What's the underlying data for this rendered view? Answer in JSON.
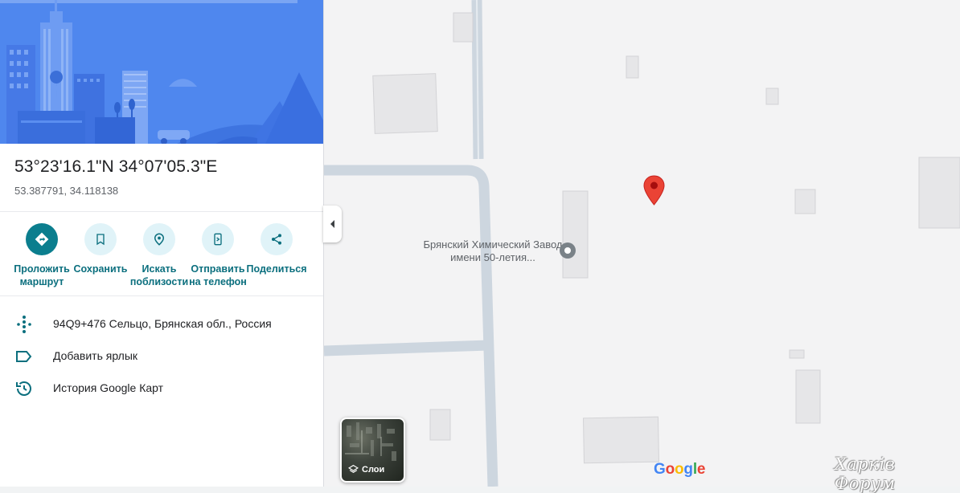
{
  "place": {
    "title": "53°23'16.1\"N 34°07'05.3\"E",
    "decimal": "53.387791, 34.118138"
  },
  "actions": [
    {
      "label": "Проложить\nмаршрут",
      "icon": "directions-icon"
    },
    {
      "label": "Сохранить",
      "icon": "bookmark-icon"
    },
    {
      "label": "Искать\nпоблизости",
      "icon": "nearby-icon"
    },
    {
      "label": "Отправить\nна телефон",
      "icon": "send-to-phone-icon"
    },
    {
      "label": "Поделиться",
      "icon": "share-icon"
    }
  ],
  "info": [
    {
      "text": "94Q9+476 Сельцо, Брянская обл., Россия",
      "icon": "plus-code-icon"
    },
    {
      "text": "Добавить ярлык",
      "icon": "label-icon"
    },
    {
      "text": "История Google Карт",
      "icon": "history-icon"
    }
  ],
  "map": {
    "poi_label": "Брянский Химический Завод имени 50-летия...",
    "layers_label": "Слои",
    "logo": "Google",
    "watermark": "Харків Форум"
  },
  "colors": {
    "accent": "#0b7e8e",
    "pin": "#ea4335",
    "hero": "#4a84ec"
  }
}
